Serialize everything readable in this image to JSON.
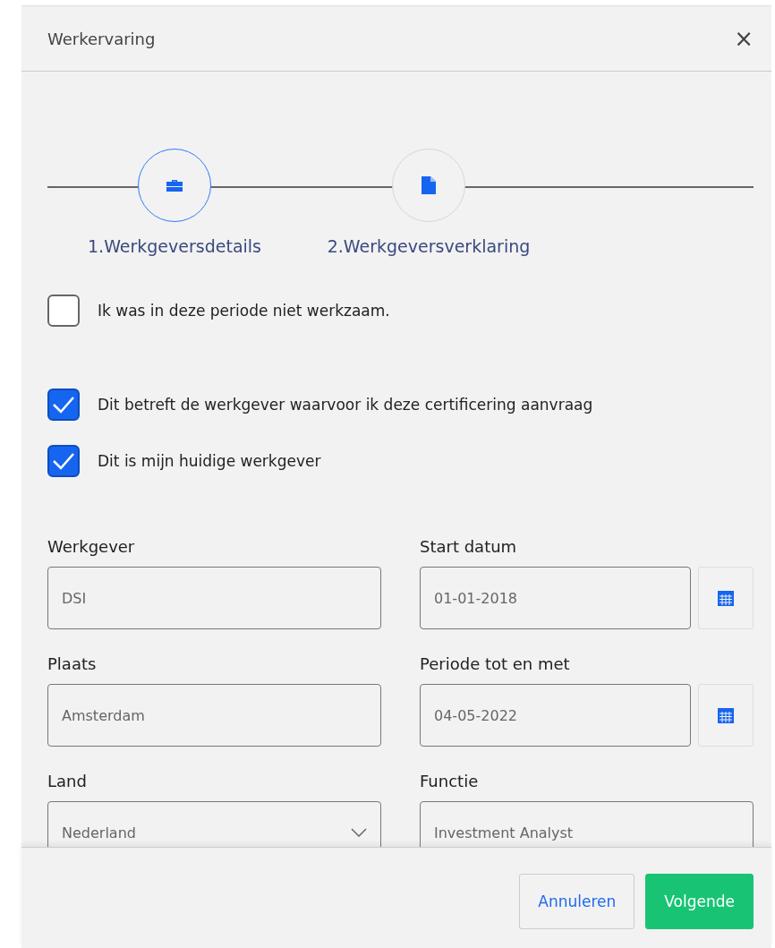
{
  "dialog": {
    "title": "Werkervaring",
    "close": "×"
  },
  "steps": [
    {
      "label": "1.Werkgeversdetails",
      "kind": "briefcase",
      "selected": true
    },
    {
      "label": "2.Werkgeversverklaring",
      "kind": "document",
      "selected": false
    }
  ],
  "checkboxes": [
    {
      "label": "Ik was in deze periode niet werkzaam.",
      "checked": false
    },
    {
      "label": "Dit betreft de werkgever waarvoor ik deze certificering aanvraag",
      "checked": true
    },
    {
      "label": "Dit is mijn huidige werkgever",
      "checked": true
    }
  ],
  "fields": [
    {
      "label": "Werkgever",
      "value": "DSI",
      "kind": "text"
    },
    {
      "label": "Start datum",
      "value": "01-01-2018",
      "kind": "date"
    },
    {
      "label": "Plaats",
      "value": "Amsterdam",
      "kind": "text"
    },
    {
      "label": "Periode tot en met",
      "value": "04-05-2022",
      "kind": "date"
    },
    {
      "label": "Land",
      "value": "Nederland",
      "kind": "select"
    },
    {
      "label": "Functie",
      "value": "Investment Analyst",
      "kind": "text"
    }
  ],
  "buttons": [
    {
      "label": "Annuleren",
      "kind": "secondary"
    },
    {
      "label": "Volgende",
      "kind": "primary"
    }
  ]
}
